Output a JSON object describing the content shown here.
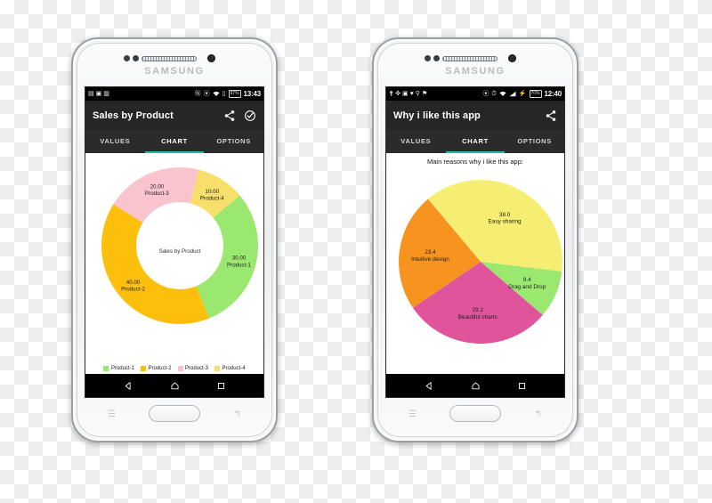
{
  "phones": {
    "left": {
      "brand": "SAMSUNG",
      "status_bar": {
        "time": "13:43",
        "battery_percent": "97%",
        "left_icons": [
          "sd-card-icon",
          "screenshot-icon",
          "download-icon"
        ],
        "right_icons": [
          "nfc-icon",
          "vibrate-icon",
          "wifi-icon",
          "signal-icon"
        ]
      },
      "app": {
        "title": "Sales by Product",
        "actions": [
          {
            "name": "share-icon",
            "label": "Share"
          },
          {
            "name": "check-circle-icon",
            "label": "Select"
          }
        ],
        "tabs": [
          {
            "label": "VALUES",
            "active": false
          },
          {
            "label": "CHART",
            "active": true
          },
          {
            "label": "OPTIONS",
            "active": false
          }
        ]
      },
      "nav_bar": [
        "back-icon",
        "home-icon",
        "recents-icon"
      ]
    },
    "right": {
      "brand": "SAMSUNG",
      "status_bar": {
        "time": "12:40",
        "battery_percent": "70%",
        "left_icons": [
          "usb-icon",
          "bluetooth-icon",
          "screenshot-icon",
          "heart-icon",
          "key-icon",
          "pin-icon"
        ],
        "right_icons": [
          "vibrate-icon",
          "alarm-icon",
          "wifi-icon",
          "signal-icon",
          "charging-icon"
        ]
      },
      "app": {
        "title": "Why i like this app",
        "actions": [
          {
            "name": "share-icon",
            "label": "Share"
          }
        ],
        "tabs": [
          {
            "label": "VALUES",
            "active": false
          },
          {
            "label": "CHART",
            "active": true
          },
          {
            "label": "OPTIONS",
            "active": false
          }
        ]
      },
      "nav_bar": [
        "back-icon",
        "home-icon",
        "recents-icon"
      ]
    }
  },
  "chart_data": [
    {
      "type": "pie",
      "variant": "donut",
      "title": "Sales by Product",
      "center_label": "Sales by Product",
      "categories": [
        "Product-1",
        "Product-2",
        "Product-3",
        "Product-4"
      ],
      "values": [
        30.0,
        40.0,
        20.0,
        10.0
      ],
      "value_labels": [
        "30.00",
        "40.00",
        "20.00",
        "10.00"
      ],
      "colors": [
        "#9BE870",
        "#FCC00C",
        "#FAC4CE",
        "#F8DE6A"
      ],
      "legend": [
        "Product-1",
        "Product-2",
        "Product-3",
        "Product-4"
      ],
      "legend_position": "bottom",
      "total": 100.0
    },
    {
      "type": "pie",
      "variant": "full",
      "title": "Main reasons why i like this app:",
      "categories": [
        "Easy sharing",
        "Drag and Drop",
        "Beautiful charts",
        "Intuitive design"
      ],
      "values": [
        38.0,
        9.4,
        29.2,
        23.4
      ],
      "value_labels": [
        "38.0",
        "9.4",
        "29.2",
        "23.4"
      ],
      "colors": [
        "#F5EE72",
        "#9BE870",
        "#E0549B",
        "#F79420"
      ],
      "legend": [],
      "legend_position": "none",
      "total": 100.0
    }
  ]
}
